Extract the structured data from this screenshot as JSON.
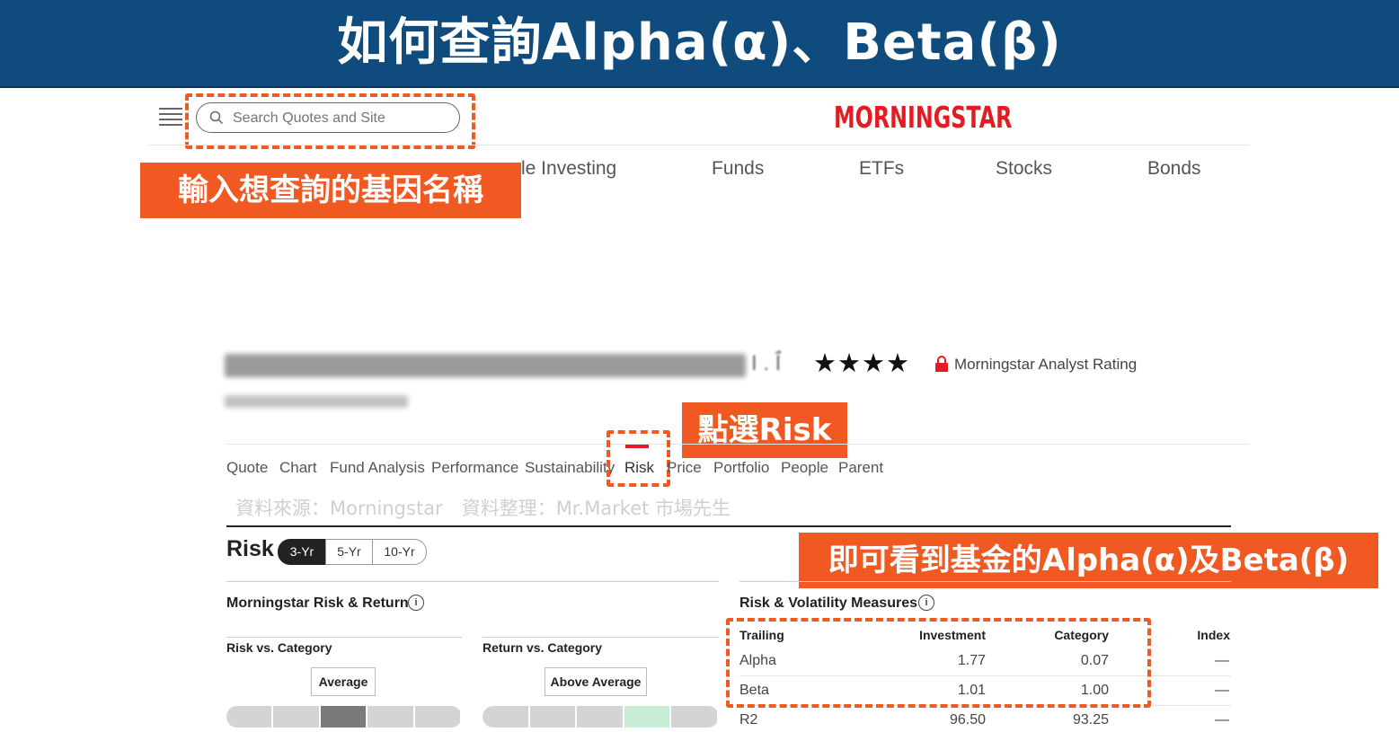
{
  "banner": {
    "title": "如何查詢Alpha(α)、Beta(β)"
  },
  "search": {
    "placeholder": "Search Quotes and Site"
  },
  "brand": {
    "logo": "MORNINGSTAR",
    "color": "#e31c23"
  },
  "annotations": {
    "search_tip": "輸入想查詢的基因名稱",
    "risk_tip": "點選Risk",
    "result_tip": "即可看到基金的Alpha(α)及Beta(β)",
    "source": "資料來源：Morningstar　資料整理：Mr.Market 市場先生",
    "accent_color": "#f05a22"
  },
  "top_nav": [
    "le Investing",
    "Funds",
    "ETFs",
    "Stocks",
    "Bonds"
  ],
  "fund": {
    "name_suffix": "I . Ī́",
    "stars": "★★★★",
    "rating_label": "Morningstar Analyst Rating"
  },
  "tabs": [
    "Quote",
    "Chart",
    "Fund Analysis",
    "Performance",
    "Sustainability",
    "Risk",
    "Price",
    "Portfolio",
    "People",
    "Parent"
  ],
  "risk": {
    "title": "Risk",
    "periods": [
      "3-Yr",
      "5-Yr",
      "10-Yr"
    ],
    "active_period": "3-Yr",
    "risk_return": {
      "title": "Morningstar Risk & Return",
      "risk_label": "Risk vs. Category",
      "risk_value": "Average",
      "risk_level_index": 2,
      "return_label": "Return vs. Category",
      "return_value": "Above Average",
      "return_level_index": 3
    },
    "measures": {
      "title": "Risk & Volatility Measures",
      "headers": [
        "Trailing",
        "Investment",
        "Category",
        "Index"
      ],
      "rows": [
        {
          "label": "Alpha",
          "investment": "1.77",
          "category": "0.07",
          "index": "—"
        },
        {
          "label": "Beta",
          "investment": "1.01",
          "category": "1.00",
          "index": "—"
        },
        {
          "label": "R2",
          "investment": "96.50",
          "category": "93.25",
          "index": "—"
        }
      ]
    }
  }
}
